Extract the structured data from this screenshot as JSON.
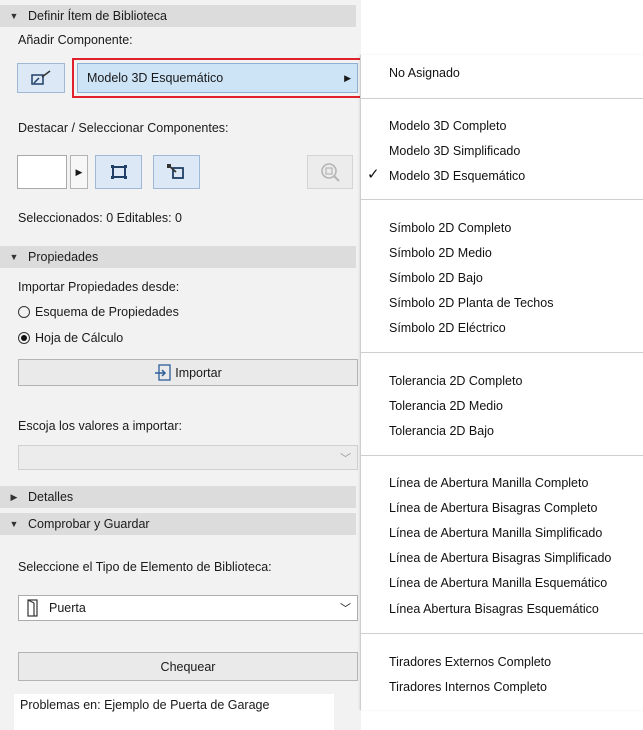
{
  "sections": {
    "define": "Definir Ítem de Biblioteca",
    "properties": "Propiedades",
    "details": "Detalles",
    "check_save": "Comprobar y Guardar"
  },
  "define": {
    "add_component_label": "Añadir Componente:",
    "component_value": "Modelo 3D Esquemático",
    "highlight_label": "Destacar / Seleccionar Componentes:",
    "selected_status": "Seleccionados: 0 Editables: 0"
  },
  "properties": {
    "import_from_label": "Importar Propiedades desde:",
    "option_schema": "Esquema de Propiedades",
    "option_sheet": "Hoja de Cálculo",
    "selected_option": "Hoja de Cálculo",
    "import_button": "Importar",
    "choose_values_label": "Escoja los valores a importar:",
    "values_select": ""
  },
  "check_save": {
    "type_label": "Seleccione el Tipo de Elemento de Biblioteca:",
    "type_value": "Puerta",
    "check_button": "Chequear",
    "problems_text": "Problemas en: Ejemplo de Puerta de Garage"
  },
  "menu": {
    "items": [
      "No Asignado",
      "Modelo 3D Completo",
      "Modelo 3D Simplificado",
      "Modelo 3D Esquemático",
      "Símbolo 2D Completo",
      "Símbolo 2D Medio",
      "Símbolo 2D Bajo",
      "Símbolo 2D Planta de Techos",
      "Símbolo 2D Eléctrico",
      "Tolerancia 2D Completo",
      "Tolerancia 2D Medio",
      "Tolerancia 2D Bajo",
      "Línea de Abertura Manilla Completo",
      "Línea de Abertura Bisagras Completo",
      "Línea de Abertura Manilla Simplificado",
      "Línea de Abertura Bisagras Simplificado",
      "Línea de Abertura Manilla Esquemático",
      "Línea Abertura Bisagras Esquemático",
      "Tiradores Externos Completo",
      "Tiradores Internos Completo"
    ],
    "checked_item": "Modelo 3D Esquemático"
  },
  "colors": {
    "highlight_border": "#e0202a",
    "combo_selected_bg": "#cde4f7",
    "panel_bg": "#f2f2f2",
    "section_header_bg": "#dcdcdc"
  },
  "icons": {
    "add_component": "component-edit-icon",
    "select_box": "select-box-icon",
    "select_corner": "select-corner-icon",
    "zoom": "zoom-icon",
    "door": "door-icon",
    "import": "import-icon"
  }
}
